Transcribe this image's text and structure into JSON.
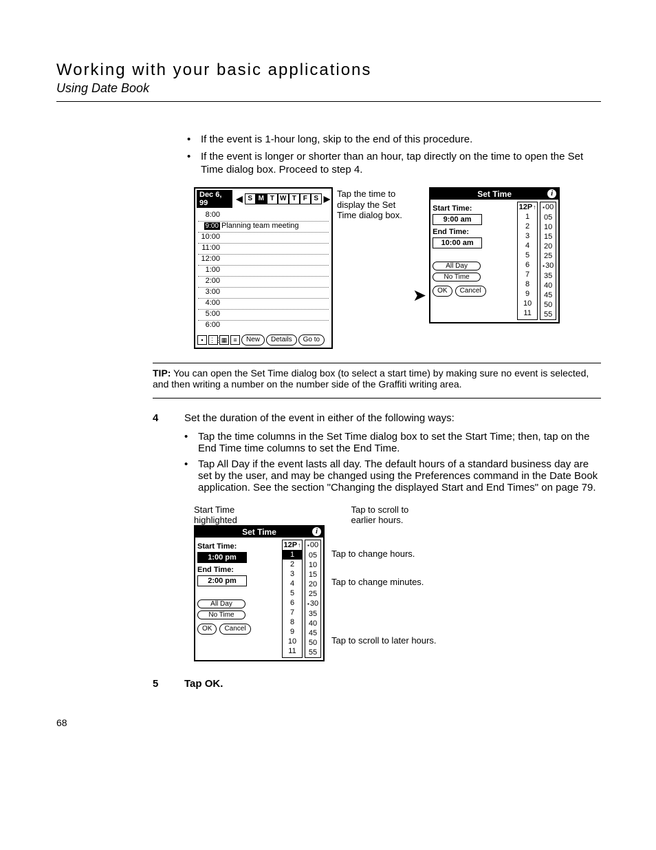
{
  "header": {
    "title": "Working with your basic applications",
    "subtitle": "Using Date Book"
  },
  "intro_bullets": [
    "If the event is 1-hour long, skip to the end of this procedure.",
    "If the event is longer or shorter than an hour, tap directly on the time to open the Set Time dialog box. Proceed to step 4."
  ],
  "fig1": {
    "datebook": {
      "date": "Dec 6, 99",
      "days": [
        "S",
        "M",
        "T",
        "W",
        "T",
        "F",
        "S"
      ],
      "selected_day_index": 1,
      "rows": [
        {
          "time": "8:00",
          "text": ""
        },
        {
          "time": "9:00",
          "text": "Planning team meeting",
          "highlight": true
        },
        {
          "time": "10:00",
          "text": ""
        },
        {
          "time": "11:00",
          "text": ""
        },
        {
          "time": "12:00",
          "text": ""
        },
        {
          "time": "1:00",
          "text": ""
        },
        {
          "time": "2:00",
          "text": ""
        },
        {
          "time": "3:00",
          "text": ""
        },
        {
          "time": "4:00",
          "text": ""
        },
        {
          "time": "5:00",
          "text": ""
        },
        {
          "time": "6:00",
          "text": ""
        }
      ],
      "buttons": {
        "new": "New",
        "details": "Details",
        "goto": "Go to"
      }
    },
    "caption": "Tap the time to display the Set Time dialog box.",
    "settime": {
      "title": "Set Time",
      "start_label": "Start Time:",
      "start_value": "9:00 am",
      "end_label": "End Time:",
      "end_value": "10:00 am",
      "allday": "All Day",
      "notime": "No Time",
      "ok": "OK",
      "cancel": "Cancel",
      "hours_top": "12P",
      "hours": [
        "1",
        "2",
        "3",
        "4",
        "5",
        "6",
        "7",
        "8",
        "9",
        "10",
        "11"
      ],
      "minutes": [
        "00",
        "05",
        "10",
        "15",
        "20",
        "25",
        "30",
        "35",
        "40",
        "45",
        "50",
        "55"
      ],
      "minute_marked": [
        0,
        6
      ]
    }
  },
  "tip": {
    "label": "TIP:",
    "text": "You can open the Set Time dialog box (to select a start time) by making sure no event is selected, and then writing a number on the number side of the Graffiti writing area."
  },
  "step4": {
    "num": "4",
    "text": "Set the duration of the event in either of the following ways:",
    "bullets": [
      "Tap the time columns in the Set Time dialog box to set the Start Time; then, tap on the End Time time columns to set the End Time.",
      "Tap All Day if the event lasts all day. The default hours of a standard business day are set by the user, and may be changed using the Preferences command in the Date Book application. See the section \"Changing the displayed Start and End Times\" on page 79."
    ]
  },
  "fig2": {
    "left_label1": "Start Time highlighted",
    "top_right": "Tap to scroll to earlier hours.",
    "settime": {
      "title": "Set Time",
      "start_label": "Start Time:",
      "start_value": "1:00 pm",
      "end_label": "End Time:",
      "end_value": "2:00 pm",
      "allday": "All Day",
      "notime": "No Time",
      "ok": "OK",
      "cancel": "Cancel",
      "hours_top": "12P",
      "hours": [
        "1",
        "2",
        "3",
        "4",
        "5",
        "6",
        "7",
        "8",
        "9",
        "10",
        "11"
      ],
      "minutes": [
        "00",
        "05",
        "10",
        "15",
        "20",
        "25",
        "30",
        "35",
        "40",
        "45",
        "50",
        "55"
      ],
      "minute_marked": [
        0,
        6
      ],
      "hour_highlight": "1"
    },
    "r1": "Tap to change hours.",
    "r2": "Tap to change minutes.",
    "r3": "Tap to scroll to later hours."
  },
  "step5": {
    "num": "5",
    "text": "Tap OK."
  },
  "page_number": "68"
}
